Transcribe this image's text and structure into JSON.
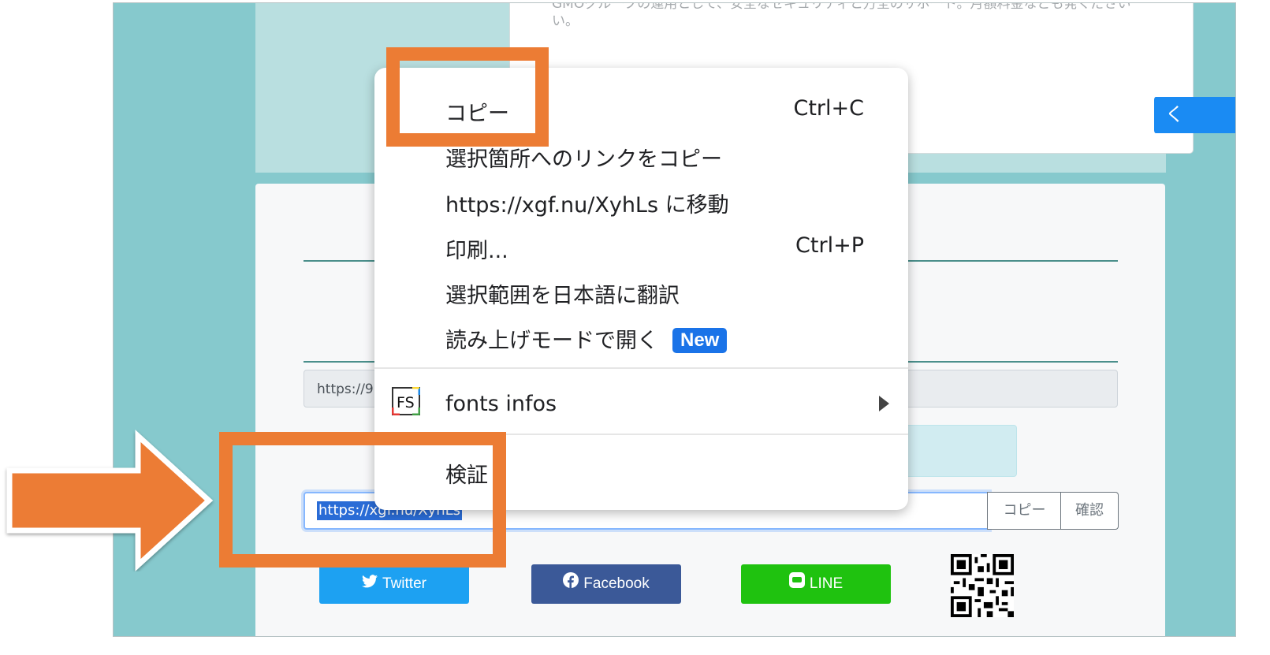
{
  "background_page": {
    "top_card_text": "GMOグループの運用として、安全なセキュリティと万全のサポート。月額料金なども発くださいい。",
    "blue_button_label": "く",
    "url_field_1": "https://9",
    "url_input_selected": "https://xgf.nu/XyhLs",
    "copy_button": "コピー",
    "confirm_button": "確認",
    "share": {
      "twitter": "Twitter",
      "facebook": "Facebook",
      "line": "LINE"
    }
  },
  "context_menu": {
    "items": [
      {
        "label": "コピー",
        "shortcut": "Ctrl+C"
      },
      {
        "label": "選択箇所へのリンクをコピー",
        "shortcut": ""
      },
      {
        "label": "https://xgf.nu/XyhLs に移動",
        "shortcut": ""
      },
      {
        "label": "印刷...",
        "shortcut": "Ctrl+P"
      },
      {
        "label": "選択範囲を日本語に翻訳",
        "shortcut": ""
      },
      {
        "label": "読み上げモードで開く",
        "shortcut": "",
        "badge": "New"
      }
    ],
    "extension_item": {
      "label": "fonts infos",
      "icon_text": "FS"
    },
    "inspect": "検証"
  },
  "colors": {
    "highlight": "#ec7c34",
    "teal_bg": "#86c9cd",
    "selection": "#2a6cd6",
    "badge": "#1a73e8"
  }
}
